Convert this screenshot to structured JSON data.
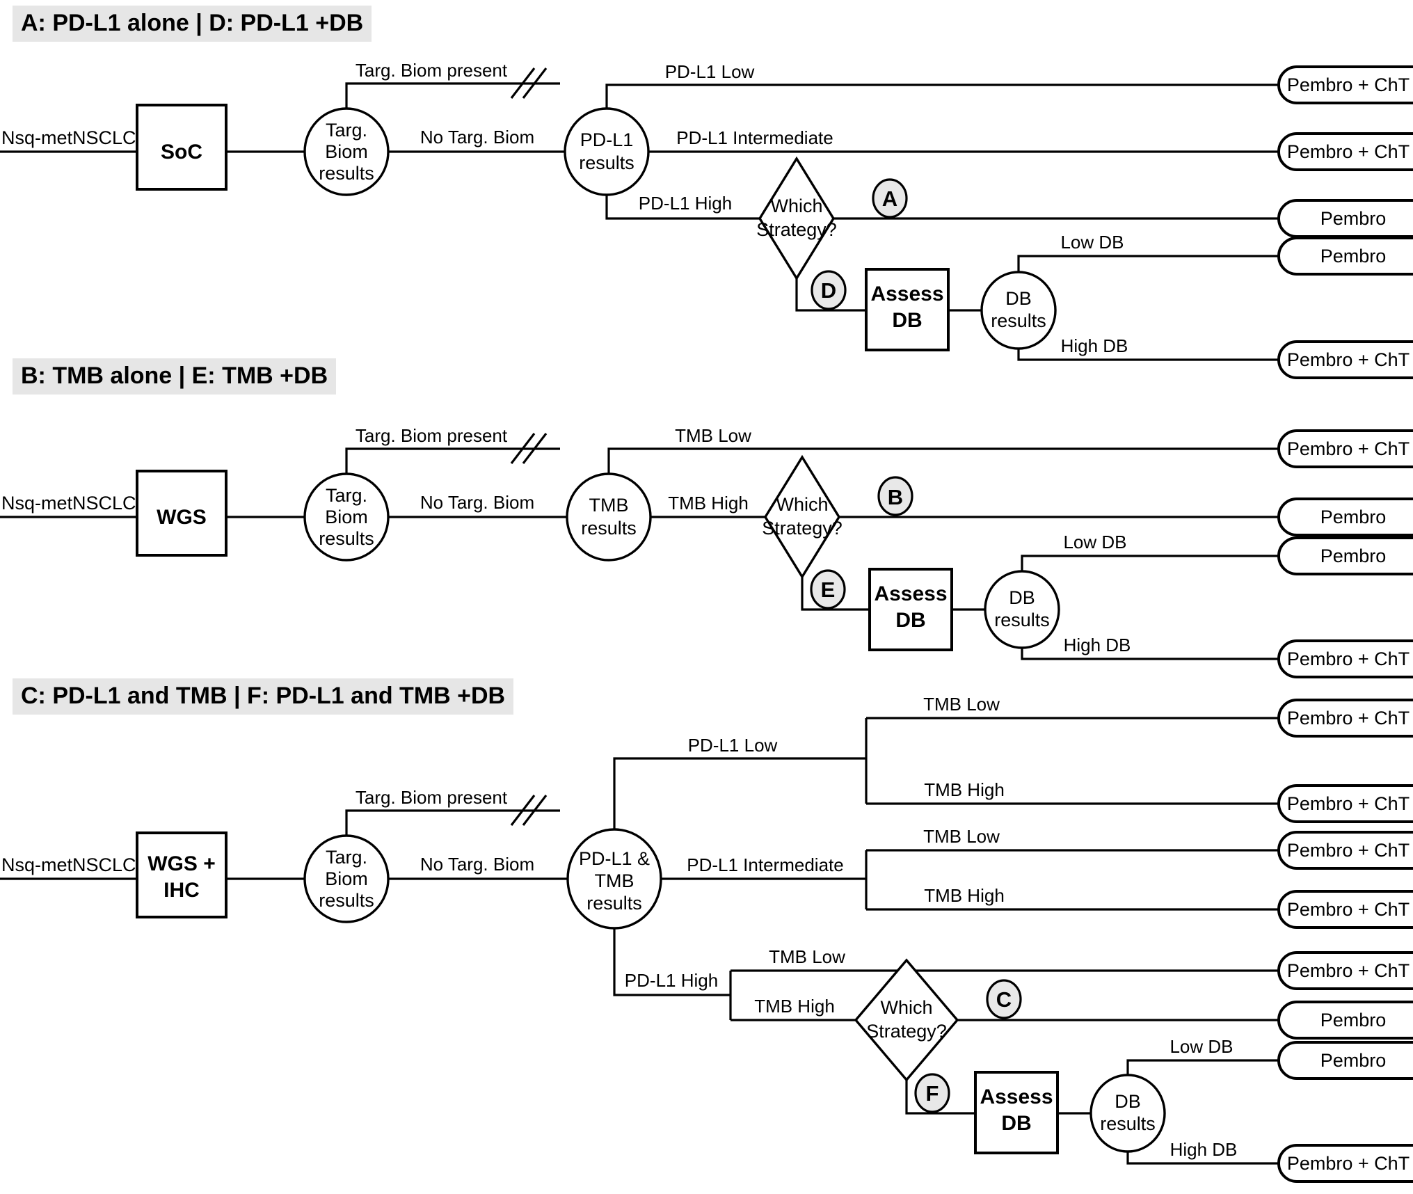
{
  "figure": {
    "type": "decision-tree",
    "title_visible": false,
    "background_color": "#ffffff",
    "line_color": "#000000",
    "header_background": "#e6e6e6",
    "marker_fill": "#e8e8e8"
  },
  "sections": [
    {
      "id": "A",
      "header": "A: PD-L1 alone | D: PD-L1 +DB",
      "root_label": "Nsq-metNSCLC",
      "test_node": "SoC",
      "chance_node_1": "Targ.\nBiom\nresults",
      "chance_node_1_lines": [
        "Targ.",
        "Biom",
        "results"
      ],
      "branch_present": "Targ. Biom present",
      "branch_absent": "No Targ. Biom",
      "chance_node_2_lines": [
        "PD-L1",
        "results"
      ],
      "outcomes": [
        {
          "edge": "PD-L1 Low",
          "terminal": "Pembro + ChT"
        },
        {
          "edge": "PD-L1  Intermediate",
          "terminal": "Pembro + ChT"
        },
        {
          "edge": "PD-L1 High",
          "terminal": "Pembro",
          "decision": "Which Strategy?",
          "marker": "A"
        }
      ],
      "decision_label_lines": [
        "Which",
        "Strategy?"
      ],
      "db_marker": "D",
      "db_node_lines": [
        "Assess",
        "DB"
      ],
      "db_results_lines": [
        "DB",
        "results"
      ],
      "db_outcomes": [
        {
          "edge": "Low DB",
          "terminal": "Pembro"
        },
        {
          "edge": "High DB",
          "terminal": "Pembro + ChT"
        }
      ]
    },
    {
      "id": "B",
      "header": "B: TMB alone | E: TMB +DB",
      "root_label": "Nsq-metNSCLC",
      "test_node": "WGS",
      "chance_node_1_lines": [
        "Targ.",
        "Biom",
        "results"
      ],
      "branch_present": "Targ. Biom present",
      "branch_absent": "No Targ. Biom",
      "chance_node_2_lines": [
        "TMB",
        "results"
      ],
      "outcomes": [
        {
          "edge": "TMB Low",
          "terminal": "Pembro + ChT"
        },
        {
          "edge": "TMB High",
          "terminal": "Pembro",
          "decision": "Which Strategy?",
          "marker": "B"
        }
      ],
      "decision_label_lines": [
        "Which",
        "Strategy?"
      ],
      "db_marker": "E",
      "db_node_lines": [
        "Assess",
        "DB"
      ],
      "db_results_lines": [
        "DB",
        "results"
      ],
      "db_outcomes": [
        {
          "edge": "Low DB",
          "terminal": "Pembro"
        },
        {
          "edge": "High DB",
          "terminal": "Pembro + ChT"
        }
      ]
    },
    {
      "id": "C",
      "header": "C: PD-L1 and TMB | F: PD-L1 and TMB +DB",
      "root_label": "Nsq-metNSCLC",
      "test_node_lines": [
        "WGS +",
        "IHC"
      ],
      "chance_node_1_lines": [
        "Targ.",
        "Biom",
        "results"
      ],
      "branch_present": "Targ. Biom present",
      "branch_absent": "No Targ. Biom",
      "chance_node_2_lines": [
        "PD-L1 &",
        "TMB",
        "results"
      ],
      "pdl1_low": "PD-L1 Low",
      "pdl1_intermediate": "PD-L1  Intermediate",
      "pdl1_high": "PD-L1 High",
      "tmb_low": "TMB Low",
      "tmb_high": "TMB High",
      "outcomes": [
        {
          "pdl1": "PD-L1 Low",
          "tmb": "TMB Low",
          "terminal": "Pembro + ChT"
        },
        {
          "pdl1": "PD-L1 Low",
          "tmb": "TMB High",
          "terminal": "Pembro + ChT"
        },
        {
          "pdl1": "PD-L1  Intermediate",
          "tmb": "TMB Low",
          "terminal": "Pembro + ChT"
        },
        {
          "pdl1": "PD-L1  Intermediate",
          "tmb": "TMB High",
          "terminal": "Pembro + ChT"
        },
        {
          "pdl1": "PD-L1 High",
          "tmb": "TMB Low",
          "terminal": "Pembro + ChT"
        },
        {
          "pdl1": "PD-L1 High",
          "tmb": "TMB High",
          "terminal": "Pembro",
          "decision": "Which Strategy?",
          "marker": "C"
        }
      ],
      "decision_label_lines": [
        "Which",
        "Strategy?"
      ],
      "db_marker": "F",
      "db_node_lines": [
        "Assess",
        "DB"
      ],
      "db_results_lines": [
        "DB",
        "results"
      ],
      "db_outcomes": [
        {
          "edge": "Low DB",
          "terminal": "Pembro"
        },
        {
          "edge": "High DB",
          "terminal": "Pembro + ChT"
        }
      ]
    }
  ],
  "labels": {
    "root": "Nsq-metNSCLC",
    "soc": "SoC",
    "wgs": "WGS",
    "wgs_ihc_1": "WGS +",
    "wgs_ihc_2": "IHC",
    "targ_1": "Targ.",
    "targ_2": "Biom",
    "targ_3": "results",
    "targ_present": "Targ. Biom present",
    "no_targ": "No Targ. Biom",
    "pdl1_1": "PD-L1",
    "pdl1_2": "results",
    "tmb_1": "TMB",
    "tmb_2": "results",
    "pdl1tmb_1": "PD-L1 &",
    "pdl1tmb_2": "TMB",
    "pdl1tmb_3": "results",
    "pdl1_low": "PD-L1 Low",
    "pdl1_intermediate": "PD-L1  Intermediate",
    "pdl1_high": "PD-L1 High",
    "tmb_low": "TMB Low",
    "tmb_high": "TMB High",
    "which_1": "Which",
    "which_2": "Strategy?",
    "assess_1": "Assess",
    "assess_2": "DB",
    "db_1": "DB",
    "db_2": "results",
    "low_db": "Low DB",
    "high_db": "High DB",
    "pembro": "Pembro",
    "pembro_cht": "Pembro + ChT",
    "marker_a": "A",
    "marker_b": "B",
    "marker_c": "C",
    "marker_d": "D",
    "marker_e": "E",
    "marker_f": "F"
  },
  "headers": {
    "a": "A: PD-L1 alone | D: PD-L1 +DB",
    "b": "B: TMB alone | E: TMB +DB",
    "c": "C: PD-L1 and TMB | F: PD-L1 and TMB +DB"
  }
}
